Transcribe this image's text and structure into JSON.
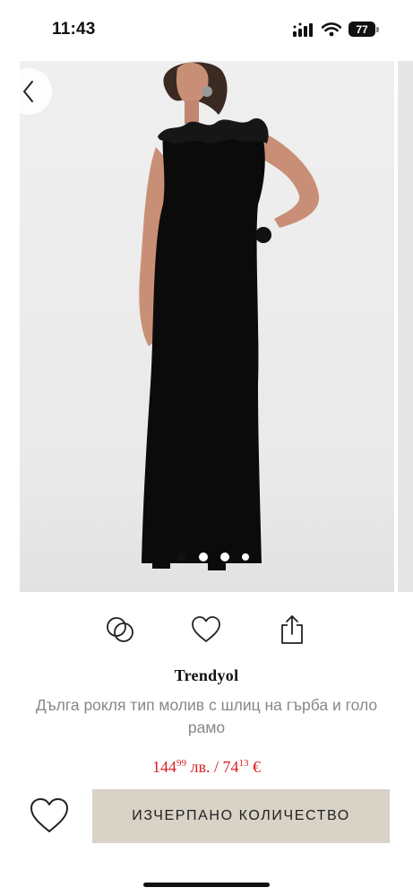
{
  "status_bar": {
    "time": "11:43",
    "battery": "77"
  },
  "product": {
    "brand": "Trendyol",
    "title": "Дълга рокля тип молив с шлиц на гърба и голо рамо",
    "price": {
      "bgn_main": "144",
      "bgn_cents": "99",
      "bgn_unit": " лв. / ",
      "eur_main": "74",
      "eur_cents": "13",
      "eur_unit": " €"
    },
    "price_color": "#d81f1f"
  },
  "gallery": {
    "total_images": 4,
    "active_index": 0
  },
  "actions": {
    "compare_icon": "compare-rings-icon",
    "favorite_icon": "heart-icon",
    "share_icon": "share-icon"
  },
  "cta": {
    "label": "ИЗЧЕРПАНО КОЛИЧЕСТВО",
    "background": "#d8d2c7"
  }
}
